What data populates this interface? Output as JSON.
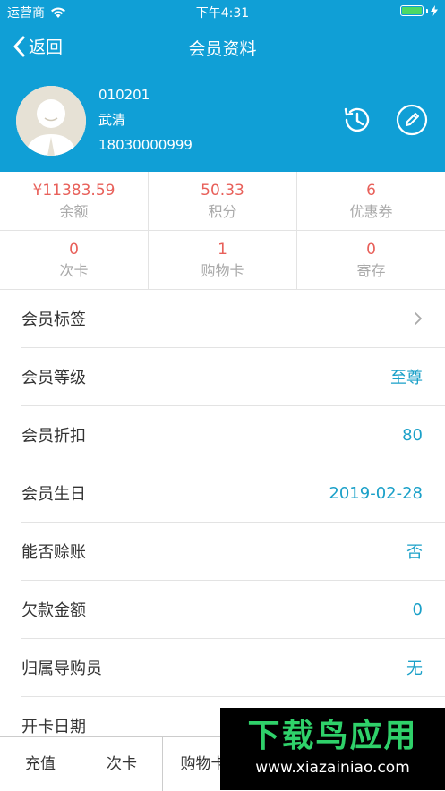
{
  "status_bar": {
    "carrier": "运营商",
    "time": "下午4:31"
  },
  "nav": {
    "back_label": "返回",
    "title": "会员资料"
  },
  "profile": {
    "member_id": "010201",
    "name": "武清",
    "phone": "18030000999"
  },
  "stats": [
    {
      "value": "¥11383.59",
      "label": "余额"
    },
    {
      "value": "50.33",
      "label": "积分"
    },
    {
      "value": "6",
      "label": "优惠券"
    },
    {
      "value": "0",
      "label": "次卡"
    },
    {
      "value": "1",
      "label": "购物卡"
    },
    {
      "value": "0",
      "label": "寄存"
    }
  ],
  "details": [
    {
      "label": "会员标签",
      "value": ""
    },
    {
      "label": "会员等级",
      "value": "至尊"
    },
    {
      "label": "会员折扣",
      "value": "80"
    },
    {
      "label": "会员生日",
      "value": "2019-02-28"
    },
    {
      "label": "能否赊账",
      "value": "否"
    },
    {
      "label": "欠款金额",
      "value": "0"
    },
    {
      "label": "归属导购员",
      "value": "无"
    },
    {
      "label": "开卡日期",
      "value": ""
    }
  ],
  "bottom_bar": {
    "recharge": "充值",
    "times_card": "次卡",
    "shopping_card": "购物卡"
  },
  "watermark": {
    "title": "下载鸟应用",
    "url": "www.xiazainiao.com"
  },
  "colors": {
    "header": "#109fd6",
    "accent_value": "#1aa0c8",
    "stat_value": "#e8605a"
  },
  "icons": {
    "history": "history-clock-icon",
    "edit": "edit-pencil-icon"
  }
}
